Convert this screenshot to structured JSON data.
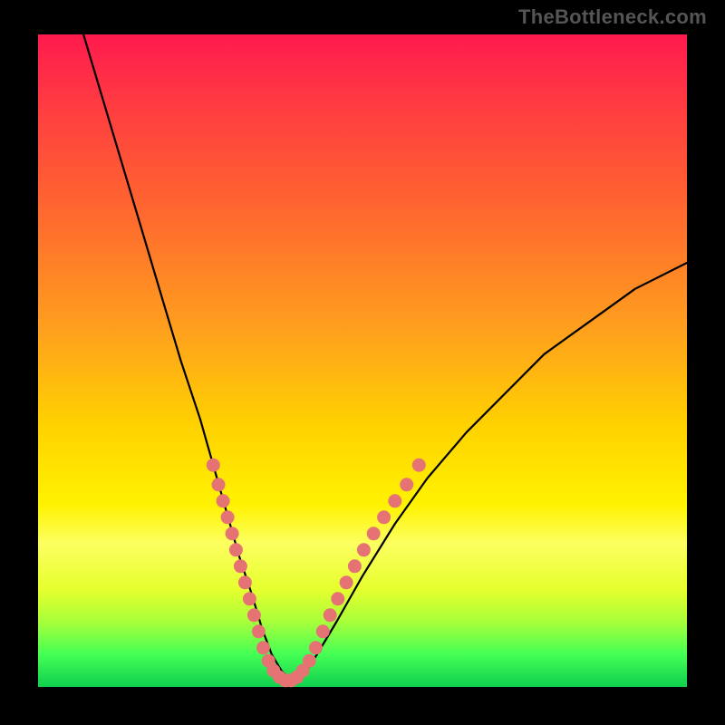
{
  "watermark": "TheBottleneck.com",
  "chart_data": {
    "type": "line",
    "title": "",
    "xlabel": "",
    "ylabel": "",
    "xlim": [
      0,
      100
    ],
    "ylim": [
      0,
      100
    ],
    "series": [
      {
        "name": "bottleneck-curve",
        "x": [
          7,
          10,
          13,
          16,
          19,
          22,
          25,
          27,
          29,
          31,
          33,
          34.5,
          36,
          37.5,
          39,
          41,
          43,
          46,
          50,
          55,
          60,
          66,
          72,
          78,
          85,
          92,
          100
        ],
        "y": [
          100,
          90,
          80,
          70,
          60,
          50,
          41,
          34,
          27,
          20,
          14,
          9,
          5,
          2.5,
          1,
          2,
          5,
          10,
          17,
          25,
          32,
          39,
          45,
          51,
          56,
          61,
          65
        ]
      }
    ],
    "markers": {
      "name": "highlight-dots",
      "color": "#e57373",
      "points": [
        {
          "x": 27.0,
          "y": 34.0
        },
        {
          "x": 27.8,
          "y": 31.0
        },
        {
          "x": 28.5,
          "y": 28.5
        },
        {
          "x": 29.2,
          "y": 26.0
        },
        {
          "x": 29.9,
          "y": 23.5
        },
        {
          "x": 30.5,
          "y": 21.0
        },
        {
          "x": 31.2,
          "y": 18.5
        },
        {
          "x": 31.9,
          "y": 16.0
        },
        {
          "x": 32.6,
          "y": 13.5
        },
        {
          "x": 33.3,
          "y": 11.0
        },
        {
          "x": 34.0,
          "y": 8.5
        },
        {
          "x": 34.7,
          "y": 6.0
        },
        {
          "x": 35.5,
          "y": 4.0
        },
        {
          "x": 36.3,
          "y": 2.5
        },
        {
          "x": 37.2,
          "y": 1.5
        },
        {
          "x": 38.1,
          "y": 1.0
        },
        {
          "x": 39.0,
          "y": 1.0
        },
        {
          "x": 39.9,
          "y": 1.5
        },
        {
          "x": 40.8,
          "y": 2.5
        },
        {
          "x": 41.8,
          "y": 4.0
        },
        {
          "x": 42.8,
          "y": 6.0
        },
        {
          "x": 43.9,
          "y": 8.5
        },
        {
          "x": 45.0,
          "y": 11.0
        },
        {
          "x": 46.2,
          "y": 13.5
        },
        {
          "x": 47.5,
          "y": 16.0
        },
        {
          "x": 48.8,
          "y": 18.5
        },
        {
          "x": 50.2,
          "y": 21.0
        },
        {
          "x": 51.7,
          "y": 23.5
        },
        {
          "x": 53.3,
          "y": 26.0
        },
        {
          "x": 55.0,
          "y": 28.5
        },
        {
          "x": 56.8,
          "y": 31.0
        },
        {
          "x": 58.7,
          "y": 34.0
        }
      ]
    },
    "gradient_stops": [
      {
        "pos": 0.0,
        "color": "#ff1a4e"
      },
      {
        "pos": 0.3,
        "color": "#ff7a24"
      },
      {
        "pos": 0.6,
        "color": "#ffd200"
      },
      {
        "pos": 0.8,
        "color": "#f5ff3a"
      },
      {
        "pos": 0.95,
        "color": "#45ff55"
      },
      {
        "pos": 1.0,
        "color": "#0fcf4e"
      }
    ]
  }
}
